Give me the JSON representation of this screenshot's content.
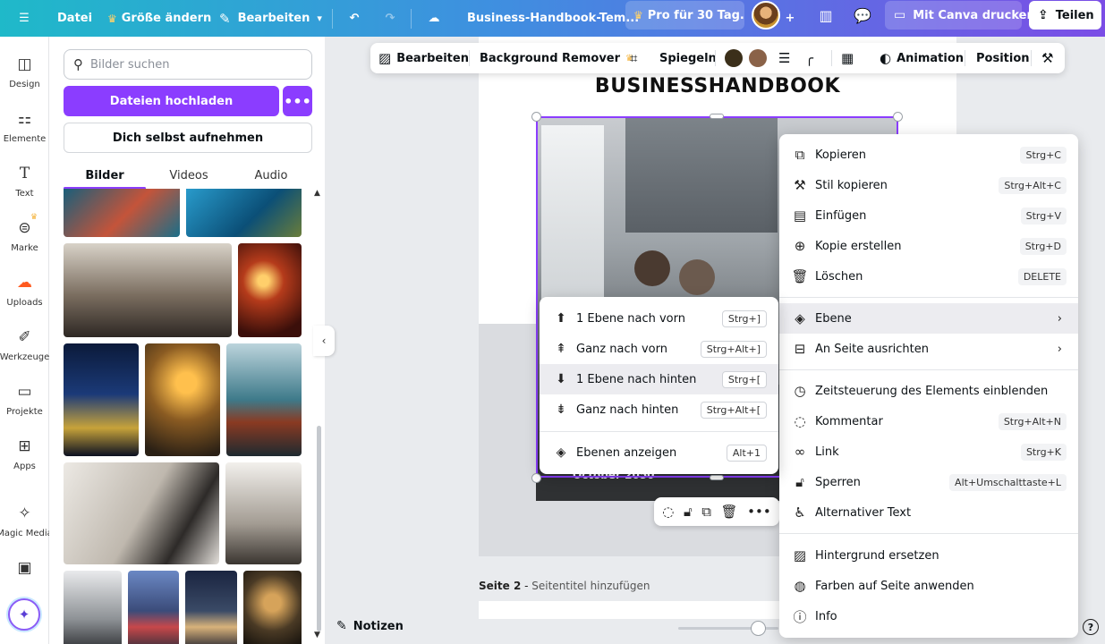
{
  "topbar": {
    "file": "Datei",
    "resize": "Größe ändern",
    "edit": "Bearbeiten",
    "title": "Business-Handbook-Tem...",
    "pro": "Pro für 30 Tag...",
    "print": "Mit Canva drucken",
    "share": "Teilen"
  },
  "rail": {
    "items": [
      {
        "label": "Design",
        "icon": "layout-icon"
      },
      {
        "label": "Elemente",
        "icon": "shapes-icon"
      },
      {
        "label": "Text",
        "icon": "text-icon"
      },
      {
        "label": "Marke",
        "icon": "brand-icon"
      },
      {
        "label": "Uploads",
        "icon": "cloud-upload-icon"
      },
      {
        "label": "Werkzeuge",
        "icon": "pen-tool-icon"
      },
      {
        "label": "Projekte",
        "icon": "folder-icon"
      },
      {
        "label": "Apps",
        "icon": "apps-grid-icon"
      },
      {
        "label": "Magic Media",
        "icon": "magic-media-icon"
      }
    ]
  },
  "panel": {
    "search_placeholder": "Bilder suchen",
    "upload": "Dateien hochladen",
    "more": "•••",
    "record": "Dich selbst aufnehmen",
    "tabs": [
      "Bilder",
      "Videos",
      "Audio"
    ]
  },
  "context_toolbar": {
    "edit": "Bearbeiten",
    "bg_remover": "Background Remover",
    "flip": "Spiegeln",
    "animation": "Animation",
    "position": "Position",
    "colors": [
      "#3b2f1a",
      "#8a6248"
    ]
  },
  "canvas": {
    "doc_title": "BUSINESSHANDBOOK",
    "date": "October 2050",
    "page2_label": "Seite 2",
    "page2_sep": " - ",
    "page2_title": "Seitentitel hinzufügen"
  },
  "bottom": {
    "notes": "Notizen",
    "help": "?"
  },
  "menu": {
    "items": [
      {
        "label": "Kopieren",
        "key": "Strg+C",
        "icon": "copy-icon"
      },
      {
        "label": "Stil kopieren",
        "key": "Strg+Alt+C",
        "icon": "paint-roller-icon"
      },
      {
        "label": "Einfügen",
        "key": "Strg+V",
        "icon": "clipboard-icon"
      },
      {
        "label": "Kopie erstellen",
        "key": "Strg+D",
        "icon": "duplicate-icon"
      },
      {
        "label": "Löschen",
        "key": "DELETE",
        "icon": "trash-icon"
      },
      {
        "label": "Ebene",
        "icon": "layers-icon"
      },
      {
        "label": "An Seite ausrichten",
        "icon": "align-icon"
      },
      {
        "label": "Zeitsteuerung des Elements einblenden",
        "icon": "clock-icon"
      },
      {
        "label": "Kommentar",
        "key": "Strg+Alt+N",
        "icon": "comment-icon"
      },
      {
        "label": "Link",
        "key": "Strg+K",
        "icon": "link-icon"
      },
      {
        "label": "Sperren",
        "key": "Alt+Umschalttaste+L",
        "icon": "lock-icon"
      },
      {
        "label": "Alternativer Text",
        "icon": "accessibility-icon"
      },
      {
        "label": "Hintergrund ersetzen",
        "icon": "pattern-icon"
      },
      {
        "label": "Farben auf Seite anwenden",
        "icon": "palette-icon"
      },
      {
        "label": "Info",
        "icon": "info-icon"
      }
    ]
  },
  "submenu": {
    "items": [
      {
        "label": "1 Ebene nach vorn",
        "key": "Strg+]"
      },
      {
        "label": "Ganz nach vorn",
        "key": "Strg+Alt+]"
      },
      {
        "label": "1 Ebene nach hinten",
        "key": "Strg+["
      },
      {
        "label": "Ganz nach hinten",
        "key": "Strg+Alt+["
      },
      {
        "label": "Ebenen anzeigen",
        "key": "Alt+1"
      }
    ]
  }
}
